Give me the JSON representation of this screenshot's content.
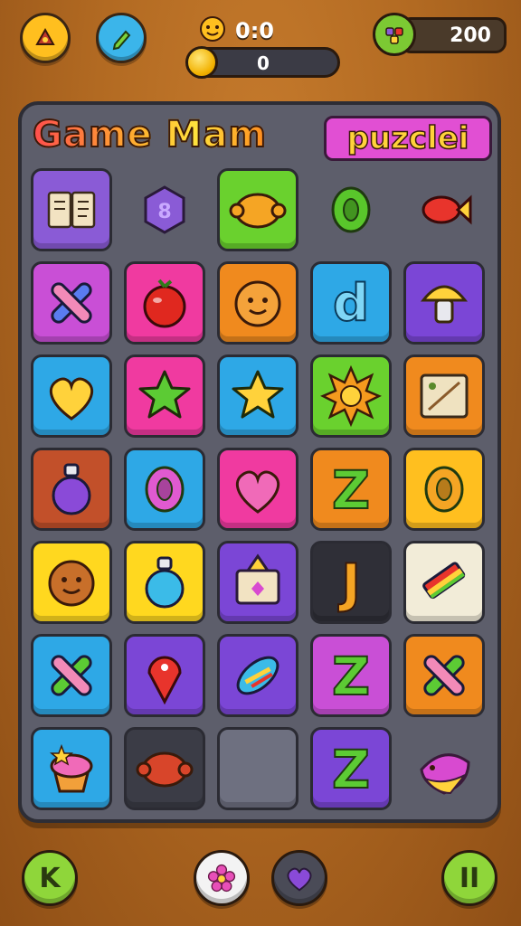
{
  "hud": {
    "score_label": "0:0",
    "progress_value": "0",
    "progress_fraction": 0.0,
    "coins_value": "200"
  },
  "title": {
    "left": "Game Mam",
    "right": "puzclei"
  },
  "board": {
    "columns": 5,
    "rows": 7,
    "tiles": [
      {
        "bg": "#8a5bd6",
        "icon": "open-book-icon",
        "glyph": "book",
        "fg": "#f2e3c2"
      },
      {
        "bg": "none",
        "icon": "purple-gem-icon",
        "glyph": "gem",
        "fg": "#8a5bd6"
      },
      {
        "bg": "#6ad12e",
        "icon": "orange-blob-icon",
        "glyph": "blob",
        "fg": "#f5a524"
      },
      {
        "bg": "none",
        "icon": "green-ring-icon",
        "glyph": "ring",
        "fg": "#59c62b"
      },
      {
        "bg": "none",
        "icon": "candy-icon",
        "glyph": "candy",
        "fg": "#e8342c"
      },
      {
        "bg": "#c94fd6",
        "icon": "cross-stick-icon",
        "glyph": "cross",
        "fg": "#5a7cf0"
      },
      {
        "bg": "#f03aa0",
        "icon": "tomato-icon",
        "glyph": "fruit",
        "fg": "#e0281f"
      },
      {
        "bg": "#f08a1e",
        "icon": "smiley-face-icon",
        "glyph": "face",
        "fg": "#f4a23a"
      },
      {
        "bg": "#2ea8e6",
        "icon": "blue-letter-icon",
        "glyph": "letter-d",
        "fg": "#7fd6f6"
      },
      {
        "bg": "#7b46d6",
        "icon": "mushroom-icon",
        "glyph": "mushroom",
        "fg": "#ffd23b"
      },
      {
        "bg": "#2ea8e6",
        "icon": "yellow-heart-icon",
        "glyph": "heart",
        "fg": "#ffd23b"
      },
      {
        "bg": "#f03aa0",
        "icon": "green-star-icon",
        "glyph": "star",
        "fg": "#5ccb34"
      },
      {
        "bg": "#2ea8e6",
        "icon": "yellow-star-face-icon",
        "glyph": "star",
        "fg": "#ffd23b"
      },
      {
        "bg": "#6ad12e",
        "icon": "sun-face-icon",
        "glyph": "sun",
        "fg": "#f59a1e"
      },
      {
        "bg": "#f08a1e",
        "icon": "treasure-map-icon",
        "glyph": "map",
        "fg": "#efe2c0"
      },
      {
        "bg": "#c2502a",
        "icon": "purple-potion-icon",
        "glyph": "potion",
        "fg": "#8a4ad8"
      },
      {
        "bg": "#2ea8e6",
        "icon": "pink-drop-icon",
        "glyph": "ring",
        "fg": "#e05ad0"
      },
      {
        "bg": "#f03aa0",
        "icon": "heart-lollipop-icon",
        "glyph": "heart",
        "fg": "#f06ab8"
      },
      {
        "bg": "#f08a1e",
        "icon": "green-letter-icon",
        "glyph": "letter-z",
        "fg": "#5ccb34"
      },
      {
        "bg": "#ffbf1f",
        "icon": "compass-ring-icon",
        "glyph": "ring",
        "fg": "#f5a524"
      },
      {
        "bg": "#ffd81f",
        "icon": "bear-face-icon",
        "glyph": "face",
        "fg": "#c86f2a"
      },
      {
        "bg": "#ffd81f",
        "icon": "blue-bottle-icon",
        "glyph": "potion",
        "fg": "#3bbbe8"
      },
      {
        "bg": "#7b46d6",
        "icon": "gift-box-icon",
        "glyph": "box",
        "fg": "#f2e3c2"
      },
      {
        "bg": "#2f2f37",
        "icon": "orange-letter-j-icon",
        "glyph": "letter-j",
        "fg": "#f5a524"
      },
      {
        "bg": "#f2ecd8",
        "icon": "rainbow-pencil-icon",
        "glyph": "pencil",
        "fg": "#e8342c"
      },
      {
        "bg": "#2ea8e6",
        "icon": "green-letter-x-icon",
        "glyph": "cross",
        "fg": "#5ccb34"
      },
      {
        "bg": "#7b46d6",
        "icon": "red-pin-icon",
        "glyph": "pin",
        "fg": "#e8342c"
      },
      {
        "bg": "#7b46d6",
        "icon": "rocket-icon",
        "glyph": "rocket",
        "fg": "#3bbbe8"
      },
      {
        "bg": "#c94fd6",
        "icon": "green-ampersand-icon",
        "glyph": "letter-z",
        "fg": "#5ccb34"
      },
      {
        "bg": "#f08a1e",
        "icon": "orange-cross-icon",
        "glyph": "cross",
        "fg": "#5ccb34"
      },
      {
        "bg": "#2ea8e6",
        "icon": "cupcake-icon",
        "glyph": "cupcake",
        "fg": "#f2a03a"
      },
      {
        "bg": "#3b3c46",
        "icon": "bean-icon",
        "glyph": "blob",
        "fg": "#d8452a"
      },
      {
        "bg": "empty",
        "icon": "empty-slot-icon",
        "glyph": "none",
        "fg": "#6e7080"
      },
      {
        "bg": "#7b46d6",
        "icon": "green-letter-z-icon",
        "glyph": "letter-z",
        "fg": "#5ccb34"
      },
      {
        "bg": "none",
        "icon": "pink-bird-icon",
        "glyph": "bird",
        "fg": "#d84ad0"
      }
    ]
  },
  "colors": {
    "board_bg": "#5d5e6b",
    "accent_yellow": "#ffd23b",
    "accent_green": "#7cc933"
  },
  "bottom_bar": {
    "left_label": "K",
    "right_label": "II"
  }
}
